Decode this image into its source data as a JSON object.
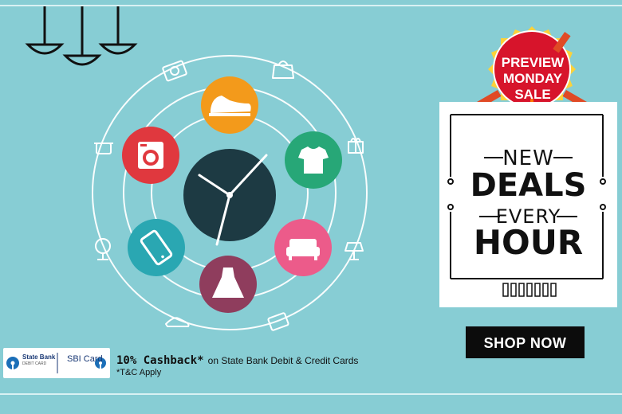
{
  "banner": {
    "badge": {
      "line1": "PREVIEW",
      "line2": "MONDAY",
      "line3": "SALE"
    },
    "deals": {
      "line1": "NEW",
      "line2": "DEALS",
      "line3": "EVERY",
      "line4": "HOUR"
    },
    "shop_label": "SHOP NOW",
    "offer": {
      "highlight": "10% Cashback*",
      "text": "on State Bank Debit & Credit Cards",
      "tnc": "*T&C Apply"
    },
    "bank_logo": {
      "bank_name": "State Bank",
      "bank_sub": "DEBIT CARD",
      "card_name": "SBI Card"
    }
  },
  "colors": {
    "background": "#87cdd4",
    "clock_face": "#1d3a43",
    "orange": "#f39a1b",
    "green": "#27a777",
    "pink": "#ec5b8a",
    "maroon": "#8f3d5d",
    "teal": "#2aa7b2",
    "red": "#e0383e",
    "badge_red": "#d7142b",
    "button": "#0c0c0c"
  },
  "icons": [
    "hanging-lamps-icon",
    "sneaker-icon",
    "tshirt-icon",
    "sofa-icon",
    "dress-icon",
    "smartphone-icon",
    "washing-machine-icon",
    "camera-icon",
    "handbag-icon",
    "gift-icon",
    "cooking-pot-icon",
    "table-fan-icon",
    "table-lamp-icon",
    "heel-shoe-icon",
    "microwave-icon"
  ]
}
